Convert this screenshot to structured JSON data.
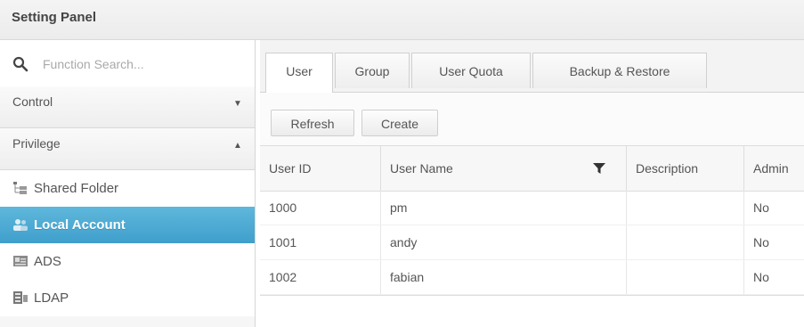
{
  "window": {
    "title": "Setting Panel"
  },
  "sidebar": {
    "search_placeholder": "Function Search...",
    "sections": [
      {
        "label": "Control",
        "arrow": "▼",
        "expanded": false
      },
      {
        "label": "Privilege",
        "arrow": "▲",
        "expanded": true
      }
    ],
    "items": [
      {
        "label": "Shared Folder",
        "icon": "folder-tree-icon",
        "active": false
      },
      {
        "label": "Local Account",
        "icon": "users-icon",
        "active": true
      },
      {
        "label": "ADS",
        "icon": "ads-card-icon",
        "active": false
      },
      {
        "label": "LDAP",
        "icon": "ldap-server-icon",
        "active": false
      }
    ],
    "accent_color": "#4aa8d2"
  },
  "tabs": [
    {
      "label": "User",
      "active": true
    },
    {
      "label": "Group",
      "active": false
    },
    {
      "label": "User Quota",
      "active": false
    },
    {
      "label": "Backup & Restore",
      "active": false
    }
  ],
  "toolbar": {
    "refresh_label": "Refresh",
    "create_label": "Create"
  },
  "table": {
    "columns": [
      "User ID",
      "User Name",
      "Description",
      "Admin"
    ],
    "rows": [
      {
        "id": "1000",
        "name": "pm",
        "description": "",
        "admin": "No"
      },
      {
        "id": "1001",
        "name": "andy",
        "description": "",
        "admin": "No"
      },
      {
        "id": "1002",
        "name": "fabian",
        "description": "",
        "admin": "No"
      }
    ]
  }
}
